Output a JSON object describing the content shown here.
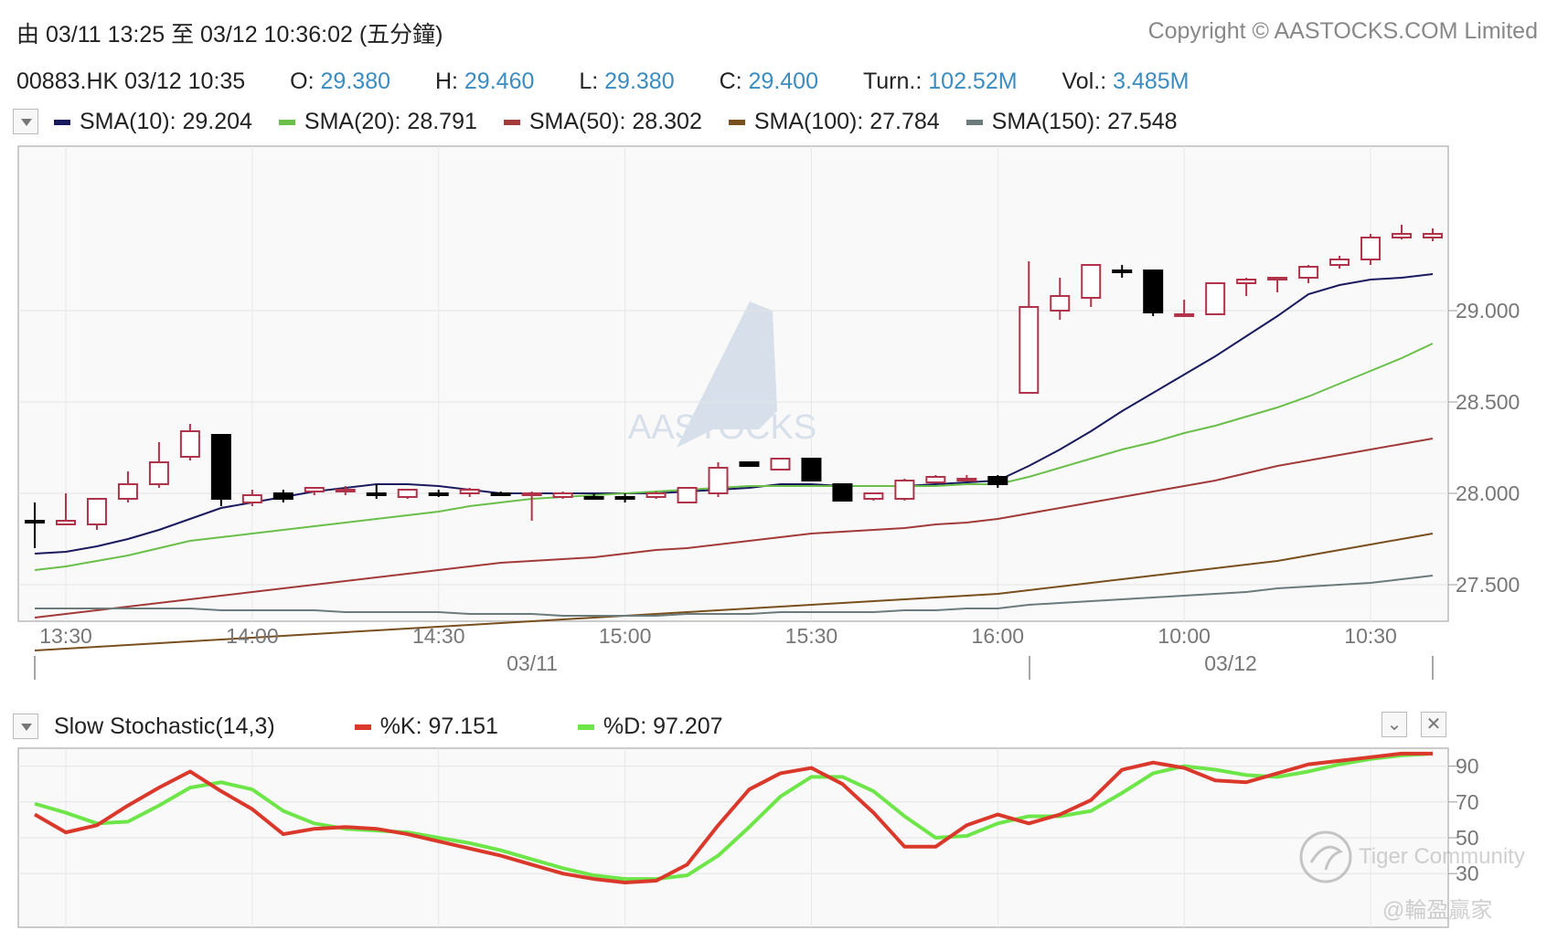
{
  "header": {
    "range_text": "由 03/11 13:25 至 03/12 10:36:02 (五分鐘)",
    "copyright": "Copyright © AASTOCKS.COM Limited"
  },
  "quote": {
    "symbol_time": "00883.HK 03/12 10:35",
    "open_label": "O:",
    "open": "29.380",
    "high_label": "H:",
    "high": "29.460",
    "low_label": "L:",
    "low": "29.380",
    "close_label": "C:",
    "close": "29.400",
    "turnover_label": "Turn.:",
    "turnover": "102.52M",
    "volume_label": "Vol.:",
    "volume": "3.485M"
  },
  "sma_legend": [
    {
      "label": "SMA(10): 29.204",
      "color": "#1a1a5e"
    },
    {
      "label": "SMA(20): 28.791",
      "color": "#6abf4b"
    },
    {
      "label": "SMA(50): 28.302",
      "color": "#a33a3a"
    },
    {
      "label": "SMA(100): 27.784",
      "color": "#7a4f1e"
    },
    {
      "label": "SMA(150): 27.548",
      "color": "#6b7b7b"
    }
  ],
  "stoch_legend": {
    "title": "Slow Stochastic(14,3)",
    "k_label": "%K: 97.151",
    "k_color": "#d9382b",
    "d_label": "%D: 97.207",
    "d_color": "#6ee64a"
  },
  "watermark": {
    "brand": "AASTOCKS",
    "tiger": "Tiger Community",
    "handle": "@輪盈贏家"
  },
  "colors": {
    "up_candle": "#b0334a",
    "down_candle": "#000000",
    "axis_text": "#777777",
    "quote_value": "#3a8cc1"
  },
  "chart_data": [
    {
      "type": "candlestick",
      "title": "",
      "ylim": [
        27.3,
        29.9
      ],
      "y_ticks": [
        "29.000",
        "28.500",
        "28.000",
        "27.500"
      ],
      "x_tick_labels": [
        "13:30",
        "14:00",
        "14:30",
        "15:00",
        "15:30",
        "16:00",
        "10:00",
        "10:30"
      ],
      "date_labels": [
        "03/11",
        "03/12"
      ],
      "grid": true,
      "candles": [
        {
          "o": 27.85,
          "h": 27.95,
          "l": 27.7,
          "c": 27.85
        },
        {
          "o": 27.83,
          "h": 28.0,
          "l": 27.83,
          "c": 27.85
        },
        {
          "o": 27.83,
          "h": 27.97,
          "l": 27.8,
          "c": 27.97
        },
        {
          "o": 27.97,
          "h": 28.12,
          "l": 27.95,
          "c": 28.05
        },
        {
          "o": 28.05,
          "h": 28.28,
          "l": 28.03,
          "c": 28.17
        },
        {
          "o": 28.2,
          "h": 28.38,
          "l": 28.18,
          "c": 28.34
        },
        {
          "o": 28.32,
          "h": 28.32,
          "l": 27.93,
          "c": 27.97
        },
        {
          "o": 27.95,
          "h": 28.02,
          "l": 27.93,
          "c": 27.99
        },
        {
          "o": 28.0,
          "h": 28.02,
          "l": 27.95,
          "c": 27.97
        },
        {
          "o": 28.01,
          "h": 28.03,
          "l": 27.99,
          "c": 28.03
        },
        {
          "o": 28.01,
          "h": 28.04,
          "l": 27.99,
          "c": 28.02
        },
        {
          "o": 28.0,
          "h": 28.05,
          "l": 27.97,
          "c": 28.0
        },
        {
          "o": 27.98,
          "h": 28.02,
          "l": 27.97,
          "c": 28.02
        },
        {
          "o": 28.0,
          "h": 28.02,
          "l": 27.98,
          "c": 28.0
        },
        {
          "o": 28.0,
          "h": 28.03,
          "l": 27.98,
          "c": 28.02
        },
        {
          "o": 28.0,
          "h": 28.01,
          "l": 27.99,
          "c": 28.0
        },
        {
          "o": 27.99,
          "h": 28.01,
          "l": 27.85,
          "c": 28.0
        },
        {
          "o": 27.98,
          "h": 28.01,
          "l": 27.97,
          "c": 28.0
        },
        {
          "o": 27.98,
          "h": 28.0,
          "l": 27.98,
          "c": 27.98
        },
        {
          "o": 27.98,
          "h": 28.0,
          "l": 27.95,
          "c": 27.98
        },
        {
          "o": 28.0,
          "h": 28.01,
          "l": 27.97,
          "c": 27.98
        },
        {
          "o": 27.95,
          "h": 28.03,
          "l": 27.95,
          "c": 28.03
        },
        {
          "o": 28.0,
          "h": 28.17,
          "l": 27.98,
          "c": 28.14
        },
        {
          "o": 28.17,
          "h": 28.17,
          "l": 28.15,
          "c": 28.15
        },
        {
          "o": 28.13,
          "h": 28.19,
          "l": 28.13,
          "c": 28.19
        },
        {
          "o": 28.19,
          "h": 28.19,
          "l": 28.07,
          "c": 28.07
        },
        {
          "o": 28.05,
          "h": 28.05,
          "l": 27.96,
          "c": 27.96
        },
        {
          "o": 27.97,
          "h": 28.0,
          "l": 27.96,
          "c": 28.0
        },
        {
          "o": 27.97,
          "h": 28.08,
          "l": 27.96,
          "c": 28.07
        },
        {
          "o": 28.06,
          "h": 28.1,
          "l": 28.06,
          "c": 28.09
        },
        {
          "o": 28.07,
          "h": 28.1,
          "l": 28.07,
          "c": 28.08
        },
        {
          "o": 28.09,
          "h": 28.1,
          "l": 28.03,
          "c": 28.05
        },
        {
          "o": 28.55,
          "h": 29.27,
          "l": 28.55,
          "c": 29.02
        },
        {
          "o": 29.0,
          "h": 29.18,
          "l": 28.95,
          "c": 29.08
        },
        {
          "o": 29.07,
          "h": 29.25,
          "l": 29.02,
          "c": 29.25
        },
        {
          "o": 29.22,
          "h": 29.25,
          "l": 29.18,
          "c": 29.22
        },
        {
          "o": 29.22,
          "h": 29.22,
          "l": 28.97,
          "c": 28.99
        },
        {
          "o": 28.98,
          "h": 29.06,
          "l": 28.97,
          "c": 28.98
        },
        {
          "o": 28.98,
          "h": 29.15,
          "l": 28.98,
          "c": 29.15
        },
        {
          "o": 29.15,
          "h": 29.18,
          "l": 29.08,
          "c": 29.17
        },
        {
          "o": 29.17,
          "h": 29.18,
          "l": 29.1,
          "c": 29.18
        },
        {
          "o": 29.18,
          "h": 29.25,
          "l": 29.15,
          "c": 29.24
        },
        {
          "o": 29.25,
          "h": 29.3,
          "l": 29.23,
          "c": 29.28
        },
        {
          "o": 29.28,
          "h": 29.42,
          "l": 29.25,
          "c": 29.4
        },
        {
          "o": 29.4,
          "h": 29.47,
          "l": 29.39,
          "c": 29.42
        },
        {
          "o": 29.42,
          "h": 29.45,
          "l": 29.38,
          "c": 29.4
        }
      ],
      "candle_direction": [
        "flat",
        "up",
        "up",
        "up",
        "up",
        "up",
        "down",
        "up",
        "down",
        "up",
        "up",
        "flat",
        "up",
        "flat",
        "up",
        "flat",
        "up",
        "up",
        "flat",
        "down",
        "up",
        "up",
        "up",
        "down",
        "up",
        "down",
        "down",
        "up",
        "up",
        "up",
        "up",
        "down",
        "up",
        "up",
        "up",
        "flat",
        "down",
        "up",
        "up",
        "up",
        "up",
        "up",
        "up",
        "up",
        "up",
        "up"
      ],
      "series": [
        {
          "name": "SMA(10)",
          "color": "#1a1a5e",
          "values": [
            27.67,
            27.68,
            27.71,
            27.75,
            27.8,
            27.86,
            27.92,
            27.95,
            27.98,
            28.01,
            28.03,
            28.05,
            28.05,
            28.04,
            28.02,
            28.0,
            28.0,
            28.0,
            28.0,
            28.0,
            28.0,
            28.01,
            28.02,
            28.03,
            28.05,
            28.05,
            28.04,
            28.04,
            28.04,
            28.05,
            28.06,
            28.07,
            28.15,
            28.24,
            28.34,
            28.45,
            28.55,
            28.65,
            28.75,
            28.86,
            28.97,
            29.09,
            29.14,
            29.17,
            29.18,
            29.2
          ]
        },
        {
          "name": "SMA(20)",
          "color": "#6abf4b",
          "values": [
            27.58,
            27.6,
            27.63,
            27.66,
            27.7,
            27.74,
            27.76,
            27.78,
            27.8,
            27.82,
            27.84,
            27.86,
            27.88,
            27.9,
            27.93,
            27.95,
            27.97,
            27.98,
            27.99,
            28.0,
            28.01,
            28.02,
            28.03,
            28.04,
            28.04,
            28.04,
            28.04,
            28.04,
            28.04,
            28.04,
            28.05,
            28.05,
            28.09,
            28.14,
            28.19,
            28.24,
            28.28,
            28.33,
            28.37,
            28.42,
            28.47,
            28.53,
            28.6,
            28.67,
            28.74,
            28.82
          ]
        },
        {
          "name": "SMA(50)",
          "color": "#a33a3a",
          "values": [
            27.32,
            27.34,
            27.36,
            27.38,
            27.4,
            27.42,
            27.44,
            27.46,
            27.48,
            27.5,
            27.52,
            27.54,
            27.56,
            27.58,
            27.6,
            27.62,
            27.63,
            27.64,
            27.65,
            27.67,
            27.69,
            27.7,
            27.72,
            27.74,
            27.76,
            27.78,
            27.79,
            27.8,
            27.81,
            27.83,
            27.84,
            27.86,
            27.89,
            27.92,
            27.95,
            27.98,
            28.01,
            28.04,
            28.07,
            28.11,
            28.15,
            28.18,
            28.21,
            28.24,
            28.27,
            28.3
          ]
        },
        {
          "name": "SMA(100)",
          "color": "#7a4f1e",
          "values": [
            27.14,
            27.15,
            27.16,
            27.17,
            27.18,
            27.19,
            27.2,
            27.21,
            27.22,
            27.23,
            27.24,
            27.25,
            27.26,
            27.27,
            27.28,
            27.29,
            27.3,
            27.31,
            27.32,
            27.33,
            27.34,
            27.35,
            27.36,
            27.37,
            27.38,
            27.39,
            27.4,
            27.41,
            27.42,
            27.43,
            27.44,
            27.45,
            27.47,
            27.49,
            27.51,
            27.53,
            27.55,
            27.57,
            27.59,
            27.61,
            27.63,
            27.66,
            27.69,
            27.72,
            27.75,
            27.78
          ]
        },
        {
          "name": "SMA(150)",
          "color": "#6b7b7b",
          "values": [
            27.37,
            27.37,
            27.37,
            27.37,
            27.37,
            27.37,
            27.36,
            27.36,
            27.36,
            27.36,
            27.35,
            27.35,
            27.35,
            27.35,
            27.34,
            27.34,
            27.34,
            27.33,
            27.33,
            27.33,
            27.33,
            27.34,
            27.34,
            27.34,
            27.35,
            27.35,
            27.35,
            27.35,
            27.36,
            27.36,
            27.37,
            27.37,
            27.39,
            27.4,
            27.41,
            27.42,
            27.43,
            27.44,
            27.45,
            27.46,
            27.48,
            27.49,
            27.5,
            27.51,
            27.53,
            27.55
          ]
        }
      ]
    },
    {
      "type": "line",
      "title": "Slow Stochastic(14,3)",
      "ylim": [
        0,
        100
      ],
      "y_ticks": [
        "90",
        "70",
        "50",
        "30"
      ],
      "grid": true,
      "series": [
        {
          "name": "%K",
          "color": "#d9382b",
          "values": [
            63,
            53,
            57,
            68,
            78,
            87,
            76,
            66,
            52,
            55,
            56,
            55,
            52,
            48,
            44,
            40,
            35,
            30,
            27,
            25,
            26,
            35,
            57,
            77,
            86,
            89,
            80,
            64,
            45,
            45,
            57,
            63,
            58,
            63,
            71,
            88,
            92,
            89,
            82,
            81,
            86,
            91,
            93,
            95,
            97,
            97
          ]
        },
        {
          "name": "%D",
          "color": "#6ee64a",
          "values": [
            69,
            64,
            58,
            59,
            68,
            78,
            81,
            77,
            65,
            58,
            55,
            54,
            53,
            50,
            47,
            43,
            38,
            33,
            29,
            27,
            27,
            29,
            40,
            56,
            73,
            84,
            84,
            76,
            62,
            50,
            51,
            58,
            62,
            62,
            65,
            75,
            86,
            90,
            88,
            85,
            84,
            87,
            91,
            94,
            96,
            97
          ]
        }
      ]
    }
  ]
}
